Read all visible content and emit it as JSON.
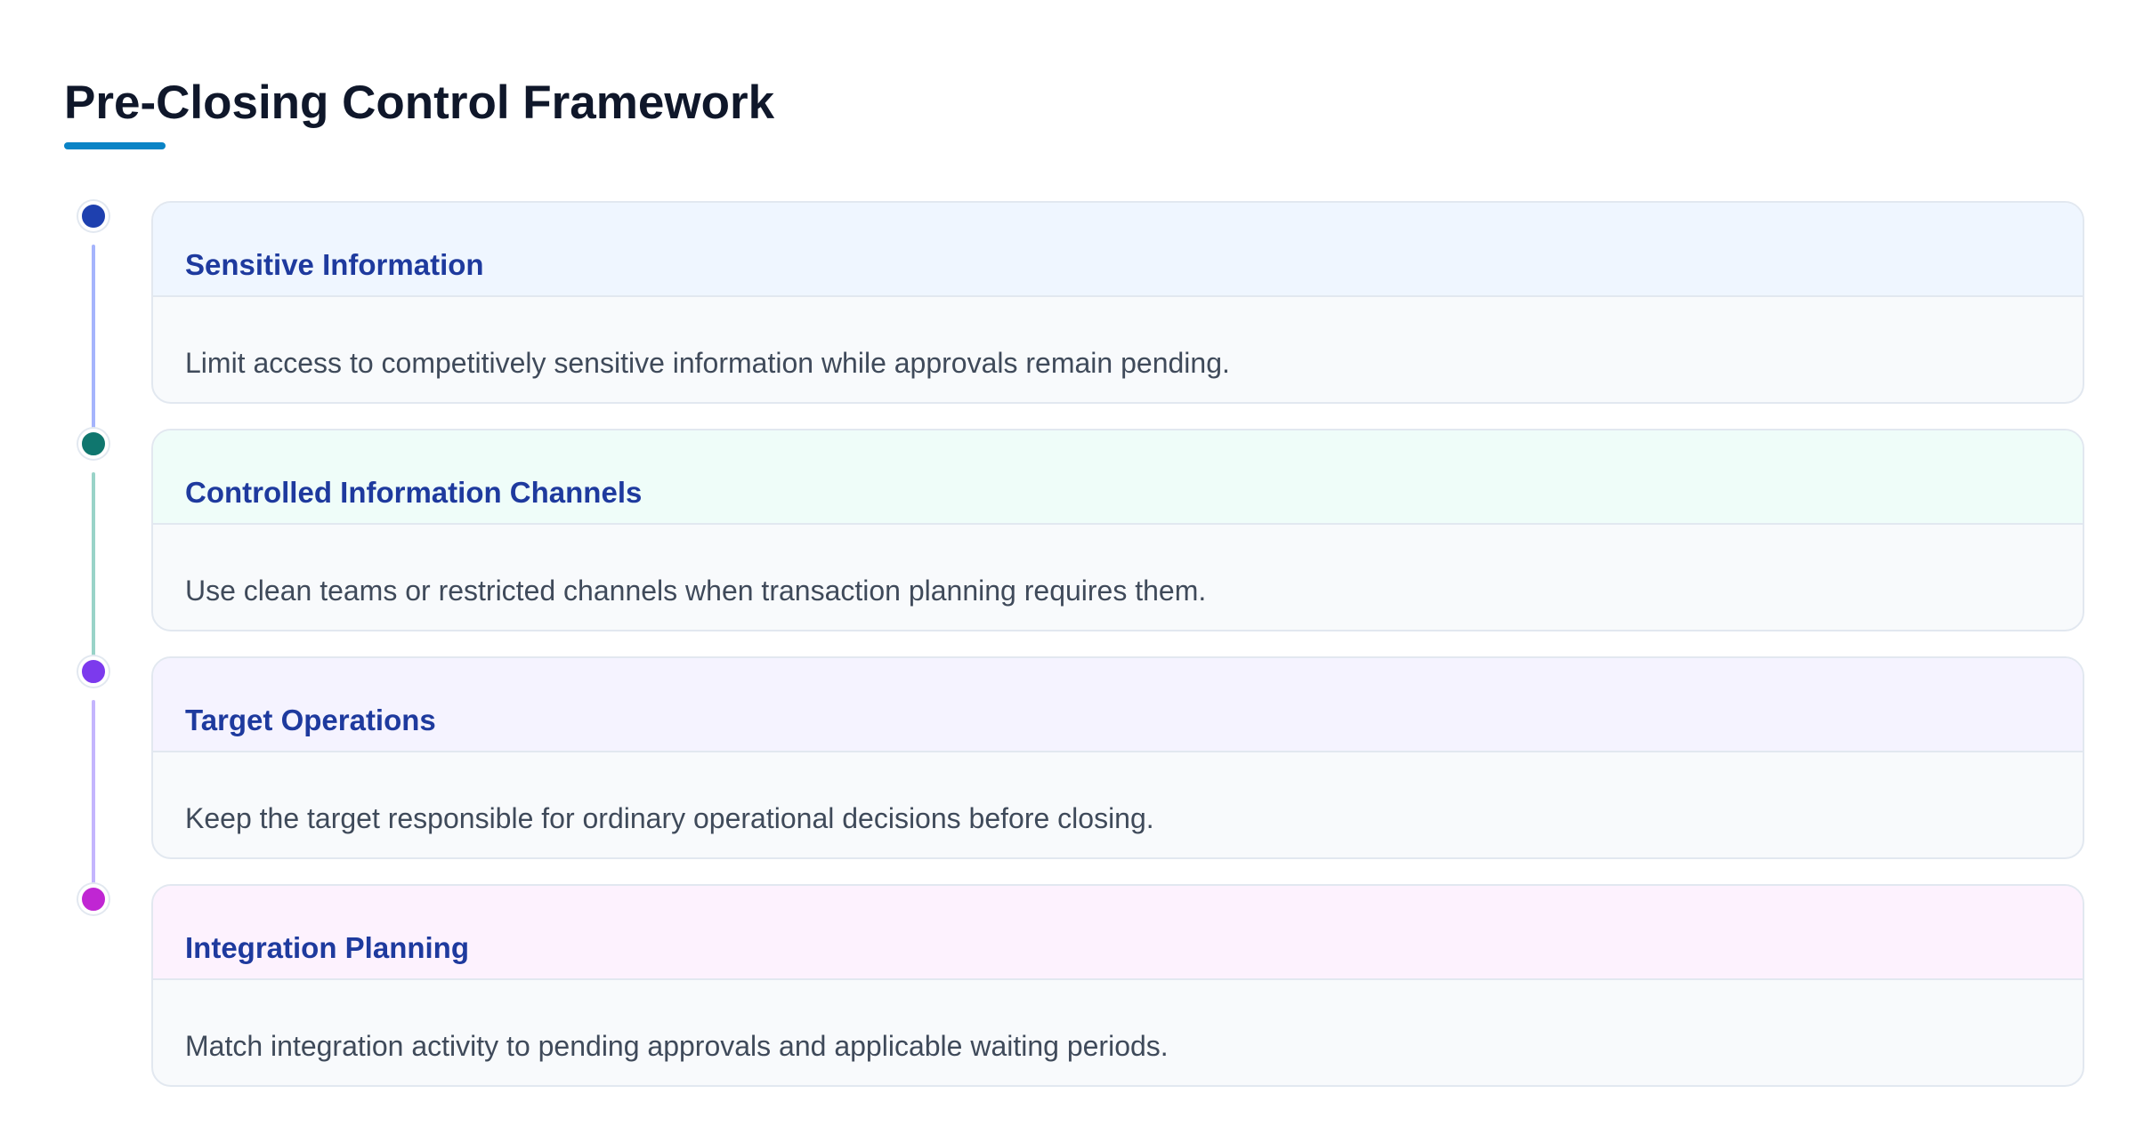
{
  "title": "Pre-Closing Control Framework",
  "colors": {
    "title_underline": "#0a84c6",
    "step_title": "#1e3a9e",
    "card_body_bg": "#f8fafc",
    "card_border": "#e2e8f0"
  },
  "steps": [
    {
      "title": "Sensitive Information",
      "description": "Limit access to competitively sensitive information while approvals remain pending.",
      "dot_color": "#1e40af",
      "line_color": "#a5b4fc",
      "head_bg": "#eff6ff"
    },
    {
      "title": "Controlled Information Channels",
      "description": "Use clean teams or restricted channels when transaction planning requires them.",
      "dot_color": "#0f766e",
      "line_color": "#99d3c8",
      "head_bg": "#effdf9"
    },
    {
      "title": "Target Operations",
      "description": "Keep the target responsible for ordinary operational decisions before closing.",
      "dot_color": "#7c3aed",
      "line_color": "#c4b5fd",
      "head_bg": "#f5f3ff"
    },
    {
      "title": "Integration Planning",
      "description": "Match integration activity to pending approvals and applicable waiting periods.",
      "dot_color": "#c026d3",
      "line_color": "#f0abfc",
      "head_bg": "#fdf2fe"
    }
  ]
}
